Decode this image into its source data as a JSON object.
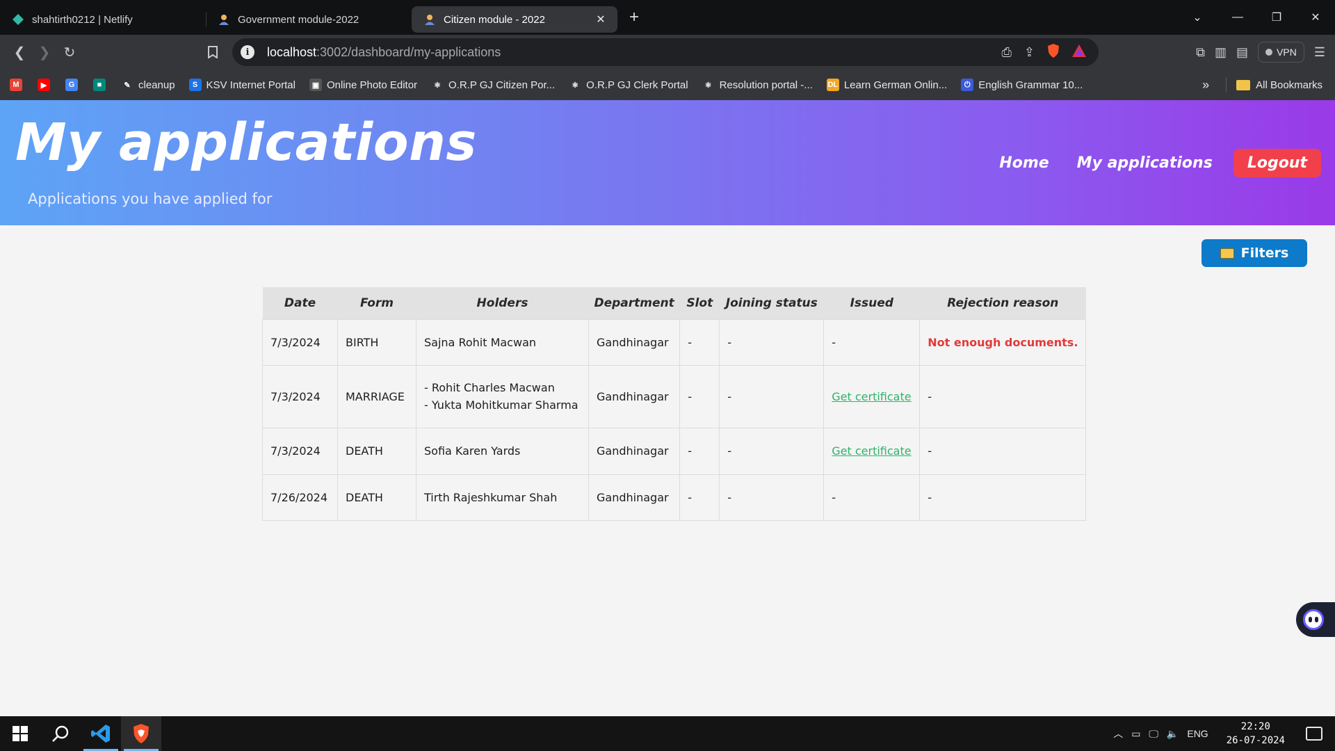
{
  "browser": {
    "tabs": [
      {
        "title": "shahtirth0212 | Netlify",
        "icon": "netlify-icon",
        "active": false
      },
      {
        "title": "Government module-2022",
        "icon": "person-icon",
        "active": false
      },
      {
        "title": "Citizen module - 2022",
        "icon": "person-icon",
        "active": true
      }
    ],
    "new_tab_label": "+",
    "close_label": "✕",
    "url_host": "localhost",
    "url_path": ":3002/dashboard/my-applications",
    "vpn_label": "VPN",
    "bookmarks": [
      {
        "label": "",
        "icon": "gmail-icon",
        "color": "#ea4335",
        "glyph": "M"
      },
      {
        "label": "",
        "icon": "youtube-icon",
        "color": "#ff0000",
        "glyph": "▶"
      },
      {
        "label": "",
        "icon": "translate-icon",
        "color": "#4285f4",
        "glyph": "G"
      },
      {
        "label": "",
        "icon": "meet-icon",
        "color": "#00897b",
        "glyph": "■"
      },
      {
        "label": "cleanup",
        "icon": "cleanup-icon",
        "color": "#35363a",
        "glyph": "✎"
      },
      {
        "label": "KSV Internet Portal",
        "icon": "ksv-icon",
        "color": "#1a73e8",
        "glyph": "S"
      },
      {
        "label": "Online Photo Editor",
        "icon": "photo-editor-icon",
        "color": "#555555",
        "glyph": "▣"
      },
      {
        "label": "O.R.P GJ Citizen Por...",
        "icon": "react-icon",
        "color": "#35363a",
        "glyph": "⚛"
      },
      {
        "label": "O.R.P GJ Clerk Portal",
        "icon": "react-icon",
        "color": "#35363a",
        "glyph": "⚛"
      },
      {
        "label": "Resolution portal -...",
        "icon": "react-icon",
        "color": "#35363a",
        "glyph": "⚛"
      },
      {
        "label": "Learn German Onlin...",
        "icon": "dl-icon",
        "color": "#f5a623",
        "glyph": "DL"
      },
      {
        "label": "English Grammar 10...",
        "icon": "grammar-icon",
        "color": "#3b5bdb",
        "glyph": "⏻"
      }
    ],
    "all_bookmarks_label": "All Bookmarks"
  },
  "header": {
    "title": "My applications",
    "subtitle": "Applications you have applied for",
    "nav": {
      "home": "Home",
      "my_applications": "My applications",
      "logout": "Logout"
    }
  },
  "filters_label": "Filters",
  "table": {
    "columns": [
      "Date",
      "Form",
      "Holders",
      "Department",
      "Slot",
      "Joining status",
      "Issued",
      "Rejection reason"
    ],
    "rows": [
      {
        "date": "7/3/2024",
        "form": "BIRTH",
        "holders": [
          "Sajna Rohit Macwan"
        ],
        "department": "Gandhinagar",
        "slot": "-",
        "joining_status": "-",
        "issued": "-",
        "rejection_reason": "Not enough documents."
      },
      {
        "date": "7/3/2024",
        "form": "MARRIAGE",
        "holders": [
          "- Rohit Charles Macwan",
          "- Yukta Mohitkumar Sharma"
        ],
        "department": "Gandhinagar",
        "slot": "-",
        "joining_status": "-",
        "issued": "Get certificate",
        "rejection_reason": "-"
      },
      {
        "date": "7/3/2024",
        "form": "DEATH",
        "holders": [
          "Sofia Karen Yards"
        ],
        "department": "Gandhinagar",
        "slot": "-",
        "joining_status": "-",
        "issued": "Get certificate",
        "rejection_reason": "-"
      },
      {
        "date": "7/26/2024",
        "form": "DEATH",
        "holders": [
          "Tirth Rajeshkumar Shah"
        ],
        "department": "Gandhinagar",
        "slot": "-",
        "joining_status": "-",
        "issued": "-",
        "rejection_reason": "-"
      }
    ]
  },
  "taskbar": {
    "language": "ENG",
    "time": "22:20",
    "date": "26-07-2024"
  },
  "colors": {
    "header_gradient_start": "#5da4f6",
    "header_gradient_end": "#9a3ae8",
    "logout_bg": "#f1404b",
    "filters_bg": "#0d7bc9",
    "rejection_text": "#e23a3a",
    "certificate_link": "#2db36a"
  }
}
